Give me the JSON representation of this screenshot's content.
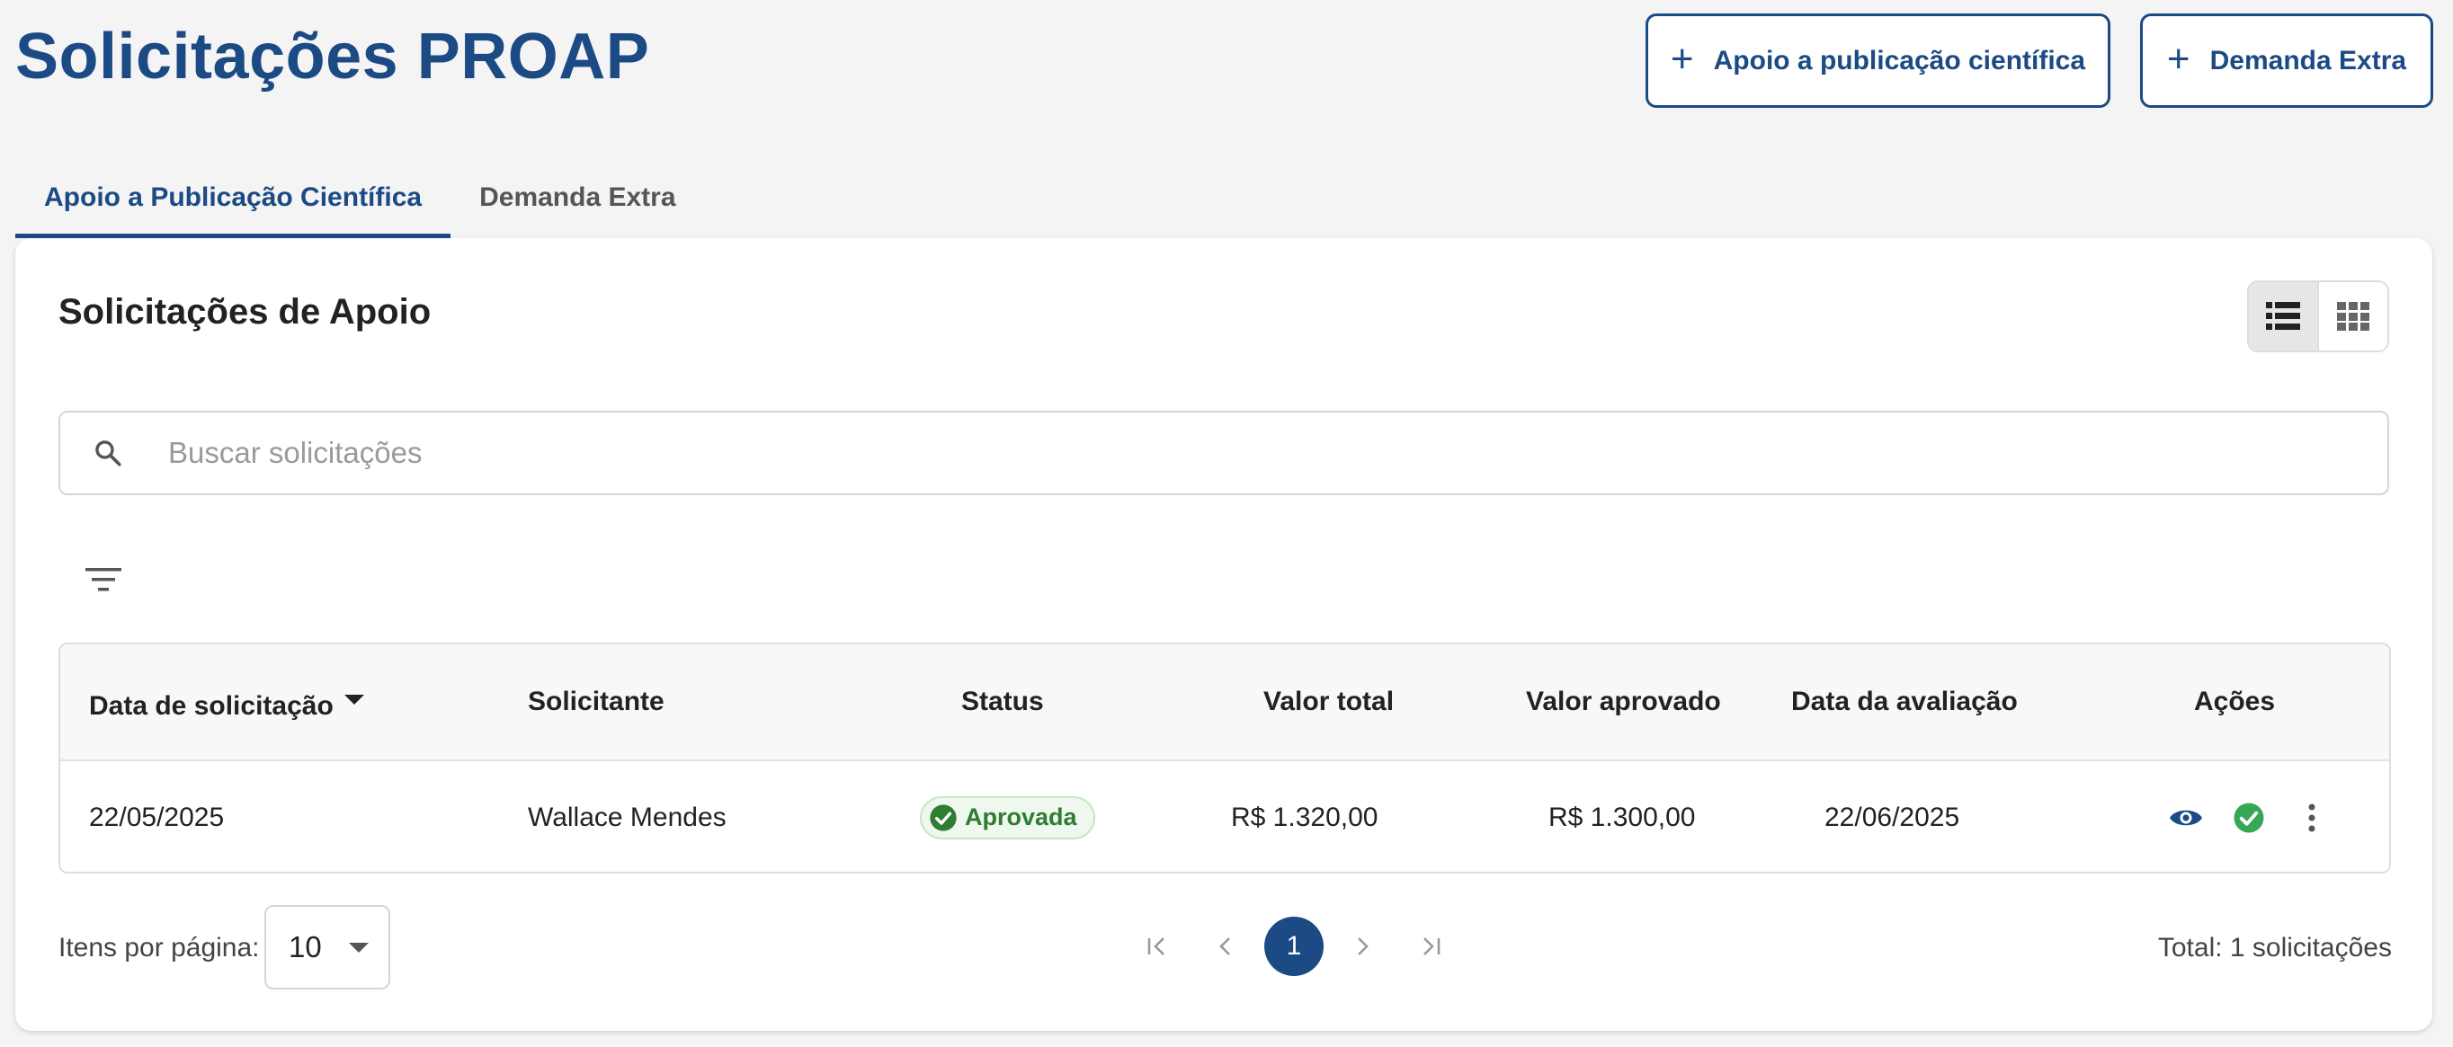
{
  "header": {
    "title": "Solicitações PROAP",
    "buttons": [
      {
        "label": "Apoio a publicação científica",
        "icon": "plus-icon"
      },
      {
        "label": "Demanda Extra",
        "icon": "plus-icon"
      }
    ]
  },
  "tabs": [
    {
      "label": "Apoio a Publicação Científica",
      "active": true
    },
    {
      "label": "Demanda Extra",
      "active": false
    }
  ],
  "card": {
    "title": "Solicitações de Apoio",
    "view_modes": [
      {
        "name": "list-view-icon",
        "active": true
      },
      {
        "name": "grid-view-icon",
        "active": false
      }
    ]
  },
  "search": {
    "placeholder": "Buscar solicitações",
    "value": ""
  },
  "table": {
    "columns": [
      "Data de solicitação",
      "Solicitante",
      "Status",
      "Valor total",
      "Valor aprovado",
      "Data da avaliação",
      "Ações"
    ],
    "sorted_column": "Data de solicitação",
    "sort_direction": "desc",
    "rows": [
      {
        "data_solicitacao": "22/05/2025",
        "solicitante": "Wallace Mendes",
        "status": "Aprovada",
        "valor_total": "R$ 1.320,00",
        "valor_aprovado": "R$ 1.300,00",
        "data_avaliacao": "22/06/2025",
        "actions": [
          "view-icon",
          "approved-check-icon",
          "more-vert-icon"
        ]
      }
    ]
  },
  "pagination": {
    "items_per_page_label": "Itens por página:",
    "items_per_page": "10",
    "current_page": "1",
    "total_label": "Total: 1 solicitações"
  },
  "colors": {
    "primary": "#1b4a84",
    "success": "#2e7d32",
    "success_icon": "#34a853",
    "background": "#f4f4f4"
  }
}
